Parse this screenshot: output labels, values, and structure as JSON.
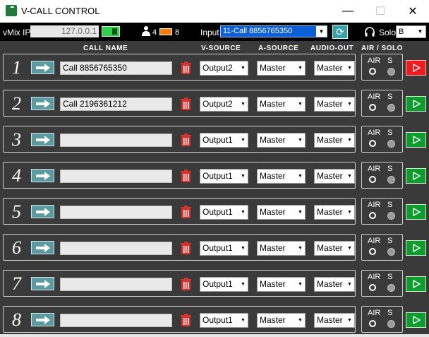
{
  "window": {
    "title": "V-CALL CONTROL",
    "minimize": "—",
    "maximize": "☐",
    "close": "✕"
  },
  "toolbar": {
    "vmix_ip_label": "vMix IP",
    "vmix_ip_value": "127.0.0.1",
    "users_count": "4",
    "battery_count": "8",
    "input_label": "Input",
    "input_selected": "11-Call 8856765350",
    "solo_label": "Solo",
    "solo_selected": "B"
  },
  "headers": {
    "call_name": "CALL NAME",
    "v_source": "V-SOURCE",
    "a_source": "A-SOURCE",
    "audio_out": "AUDIO-OUT",
    "air_solo": "AIR / SOLO"
  },
  "rows": [
    {
      "num": "1",
      "call_name": "Call 8856765350",
      "v_source": "Output2",
      "a_source": "Master",
      "audio_out": "Master",
      "air": "AIR",
      "solo": "S",
      "live": true
    },
    {
      "num": "2",
      "call_name": "Call 2196361212",
      "v_source": "Output2",
      "a_source": "Master",
      "audio_out": "Master",
      "air": "AIR",
      "solo": "S",
      "live": false
    },
    {
      "num": "3",
      "call_name": "",
      "v_source": "Output1",
      "a_source": "Master",
      "audio_out": "Master",
      "air": "AIR",
      "solo": "S",
      "live": false
    },
    {
      "num": "4",
      "call_name": "",
      "v_source": "Output1",
      "a_source": "Master",
      "audio_out": "Master",
      "air": "AIR",
      "solo": "S",
      "live": false
    },
    {
      "num": "5",
      "call_name": "",
      "v_source": "Output1",
      "a_source": "Master",
      "audio_out": "Master",
      "air": "AIR",
      "solo": "S",
      "live": false
    },
    {
      "num": "6",
      "call_name": "",
      "v_source": "Output1",
      "a_source": "Master",
      "audio_out": "Master",
      "air": "AIR",
      "solo": "S",
      "live": false
    },
    {
      "num": "7",
      "call_name": "",
      "v_source": "Output1",
      "a_source": "Master",
      "audio_out": "Master",
      "air": "AIR",
      "solo": "S",
      "live": false
    },
    {
      "num": "8",
      "call_name": "",
      "v_source": "Output1",
      "a_source": "Master",
      "audio_out": "Master",
      "air": "AIR",
      "solo": "S",
      "live": false
    }
  ],
  "icons": {
    "go": "arrow-right-icon",
    "delete": "trash-icon",
    "play": "play-icon",
    "refresh": "refresh-icon",
    "users": "users-icon",
    "headphones": "headphones-icon"
  },
  "colors": {
    "background": "#3a3a3a",
    "toolbar": "#000000",
    "connected": "#2fd14a",
    "play_idle": "#0d9c2e",
    "play_live": "#ee1c1c",
    "delete": "#d9322a",
    "input_highlight": "#0c5fd4"
  }
}
